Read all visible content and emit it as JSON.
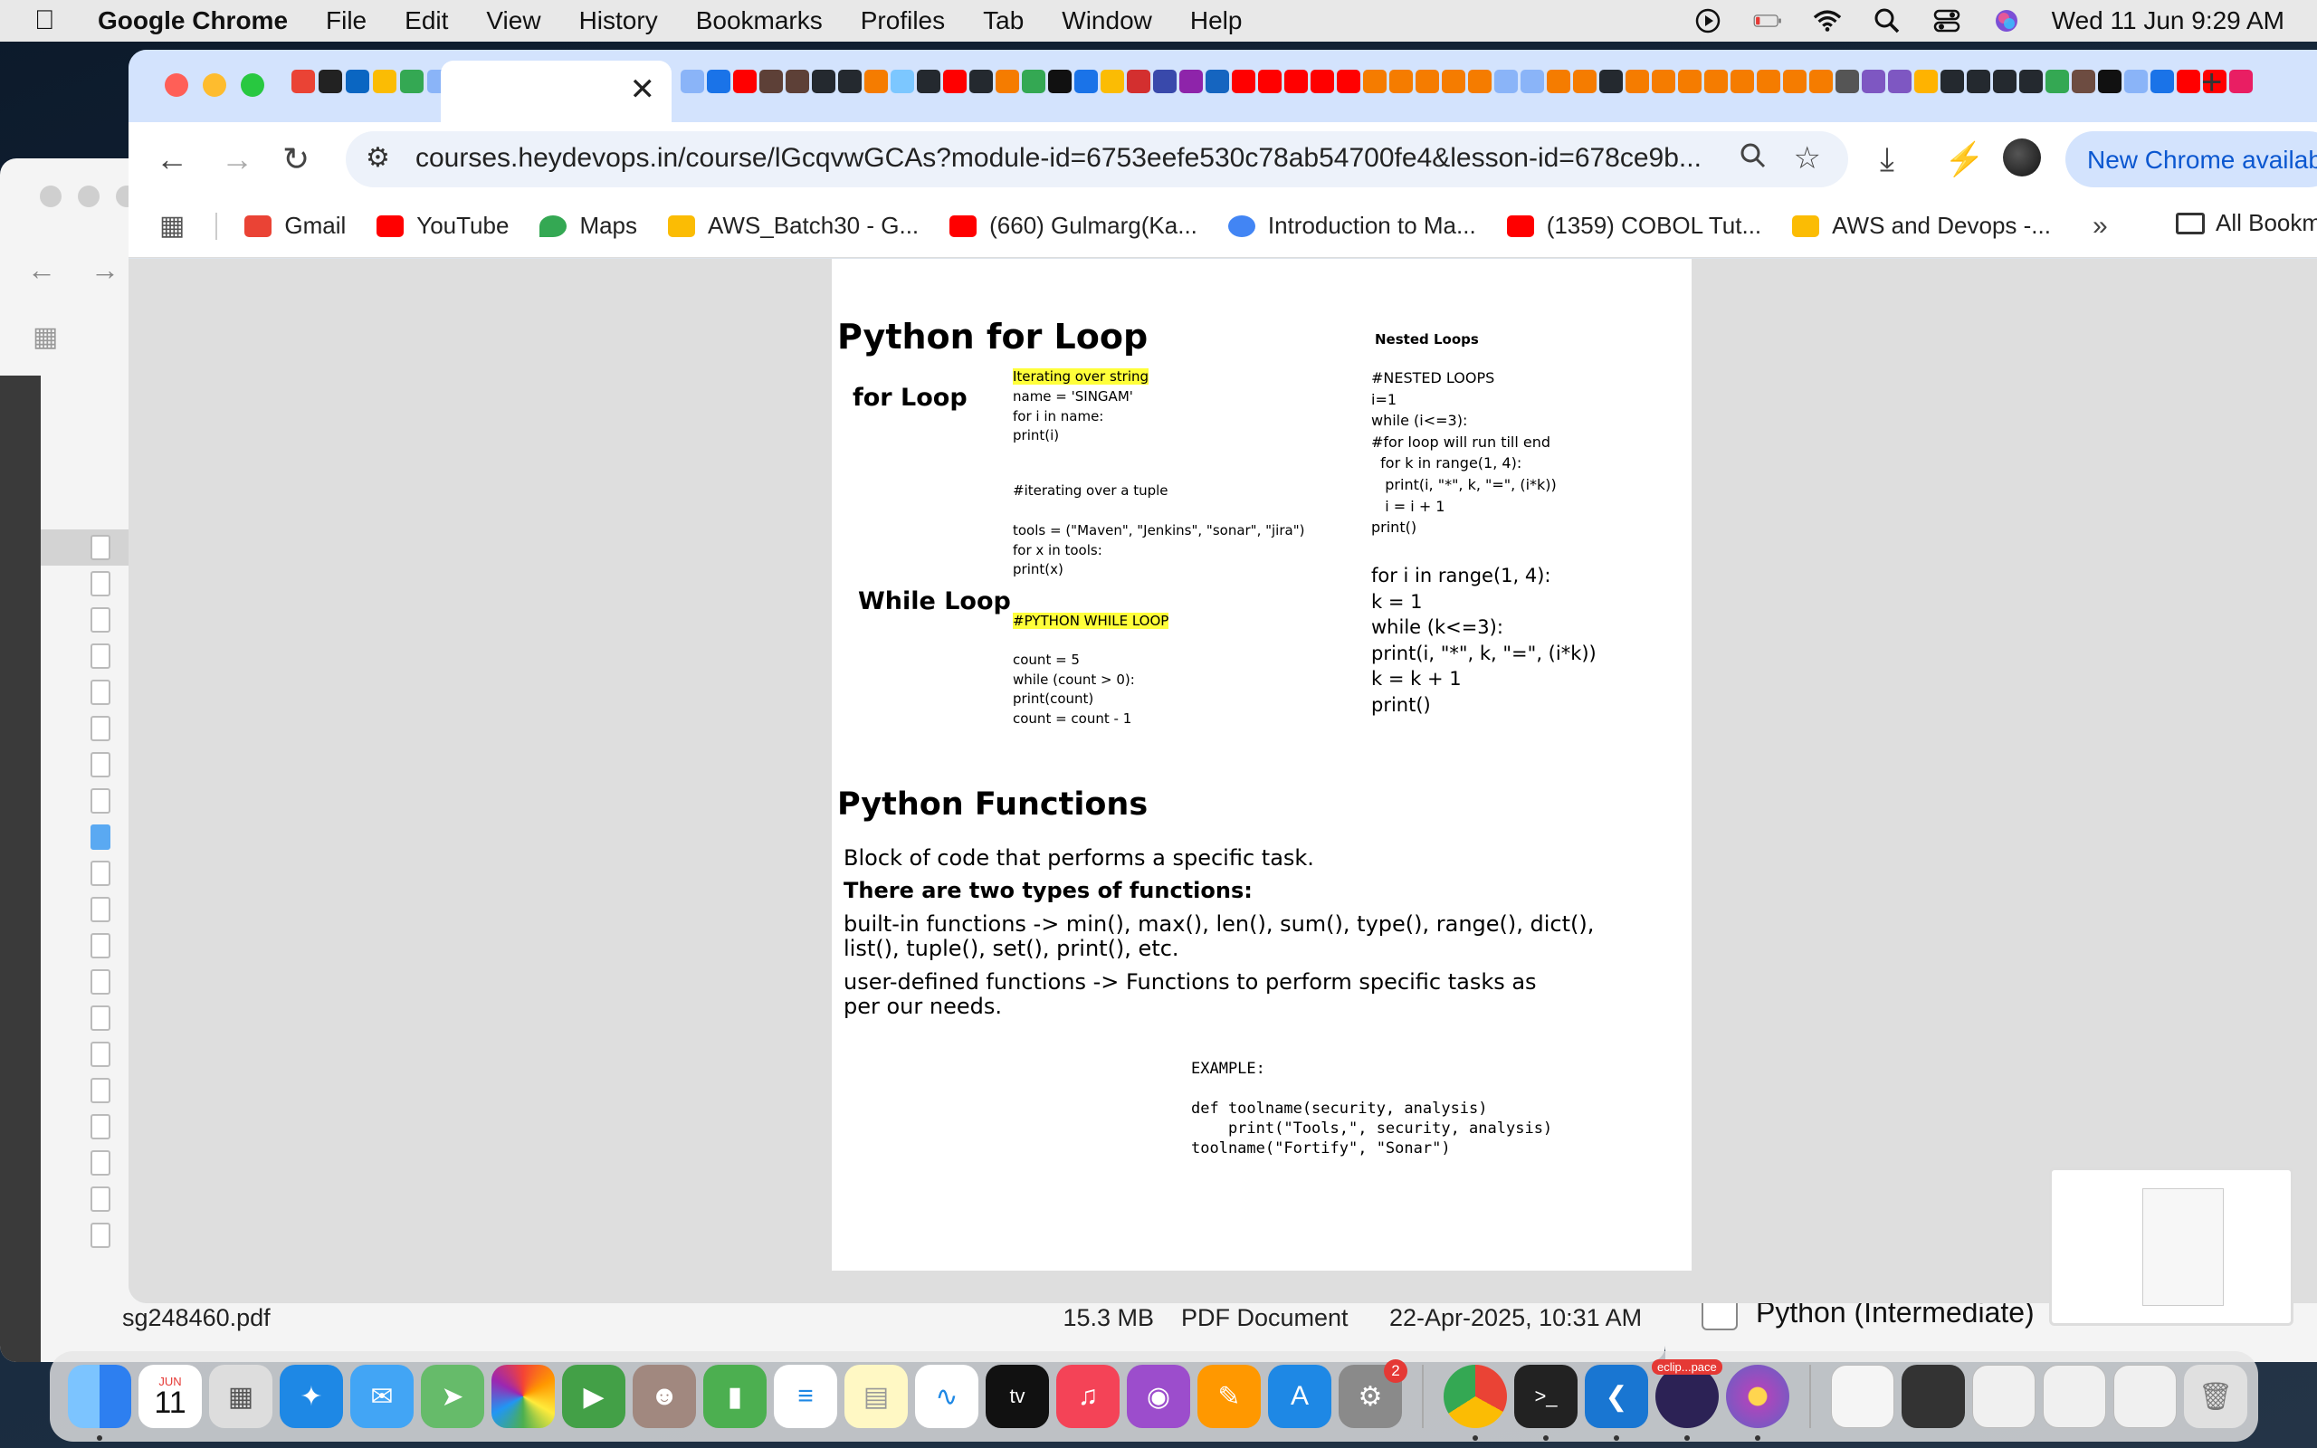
{
  "menubar": {
    "app_name": "Google Chrome",
    "items": [
      "File",
      "Edit",
      "View",
      "History",
      "Bookmarks",
      "Profiles",
      "Tab",
      "Window",
      "Help"
    ],
    "datetime": "Wed 11 Jun  9:29 AM"
  },
  "chrome": {
    "url": "courses.heydevops.in/course/lGcqvwGCAs?module-id=6753eefe530c78ab54700fe4&lesson-id=678ce9b...",
    "update_button": "New Chrome available",
    "bookmarks": [
      {
        "label": "Gmail",
        "color": "#ea4335"
      },
      {
        "label": "YouTube",
        "color": "#ff0000"
      },
      {
        "label": "Maps",
        "color": "#34a853"
      },
      {
        "label": "AWS_Batch30 - G...",
        "color": "#fbbc04"
      },
      {
        "label": "(660) Gulmarg(Ka...",
        "color": "#ff0000"
      },
      {
        "label": "Introduction to Ma...",
        "color": "#4285f4"
      },
      {
        "label": "(1359) COBOL Tut...",
        "color": "#ff0000"
      },
      {
        "label": "AWS and Devops -...",
        "color": "#fbbc04"
      }
    ],
    "all_bookmarks": "All Bookmarks"
  },
  "slide": {
    "title_loop": "Python for Loop",
    "for_loop_label": "for Loop",
    "iter_string_heading": "Iterating over string",
    "iter_string_code": "name = 'SINGAM'\nfor i in name:\nprint(i)",
    "iter_tuple_heading": "#iterating over a tuple",
    "iter_tuple_code": "tools = (\"Maven\", \"Jenkins\", \"sonar\", \"jira\")\nfor x in tools:\nprint(x)",
    "while_loop_label": "While Loop",
    "while_heading": "#PYTHON WHILE LOOP",
    "while_code": "count = 5\nwhile (count > 0):\nprint(count)\ncount = count - 1",
    "nested_label": "Nested Loops",
    "nested_code": "#NESTED LOOPS\ni=1\nwhile (i<=3):\n#for loop will run till end\n  for k in range(1, 4):\n   print(i, \"*\", k, \"=\", (i*k))\n   i = i + 1\nprint()",
    "nested_code2": "for i in range(1, 4):\nk = 1\nwhile (k<=3):\nprint(i, \"*\", k, \"=\", (i*k))\nk = k + 1\nprint()",
    "title_functions": "Python Functions",
    "func_desc": "Block of code that performs a specific task.",
    "func_types_heading": "There are two types of functions:",
    "builtin_text": "built-in functions -> min(), max(), len(), sum(), type(), range(), dict(),\nlist(), tuple(), set(), print(), etc.",
    "userdef_text": "user-defined functions -> Functions to perform specific tasks as\nper our needs.",
    "example_code": "EXAMPLE:\n\ndef toolname(security, analysis)\n    print(\"Tools,\", security, analysis)\ntoolname(\"Fortify\", \"Sonar\")"
  },
  "finder": {
    "file_name": "sg248460.pdf",
    "file_size": "15.3 MB",
    "file_kind": "PDF Document",
    "file_date": "22-Apr-2025, 10:31 AM"
  },
  "peek": {
    "label": "Python (Intermediate)"
  },
  "dock": {
    "calendar_month": "JUN",
    "calendar_day": "11",
    "settings_badge": "2",
    "eclipse_label": "eclip...pace"
  }
}
